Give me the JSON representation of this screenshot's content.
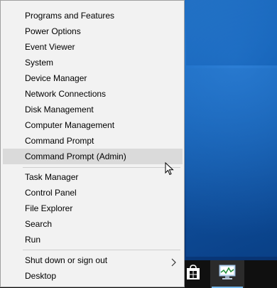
{
  "menu": {
    "group1": [
      {
        "id": "programs-and-features",
        "label": "Programs and Features"
      },
      {
        "id": "power-options",
        "label": "Power Options"
      },
      {
        "id": "event-viewer",
        "label": "Event Viewer"
      },
      {
        "id": "system",
        "label": "System"
      },
      {
        "id": "device-manager",
        "label": "Device Manager"
      },
      {
        "id": "network-connections",
        "label": "Network Connections"
      },
      {
        "id": "disk-management",
        "label": "Disk Management"
      },
      {
        "id": "computer-management",
        "label": "Computer Management"
      },
      {
        "id": "command-prompt",
        "label": "Command Prompt"
      },
      {
        "id": "command-prompt-admin",
        "label": "Command Prompt (Admin)",
        "highlighted": true
      }
    ],
    "group2": [
      {
        "id": "task-manager",
        "label": "Task Manager"
      },
      {
        "id": "control-panel",
        "label": "Control Panel"
      },
      {
        "id": "file-explorer",
        "label": "File Explorer"
      },
      {
        "id": "search",
        "label": "Search"
      },
      {
        "id": "run",
        "label": "Run"
      }
    ],
    "group3": [
      {
        "id": "shut-down-or-sign-out",
        "label": "Shut down or sign out",
        "submenu": true
      },
      {
        "id": "desktop",
        "label": "Desktop"
      }
    ]
  },
  "taskbar": {
    "items": [
      {
        "id": "store",
        "icon": "store-icon"
      },
      {
        "id": "performance-monitor",
        "icon": "performance-monitor-icon",
        "active": true
      }
    ]
  },
  "colors": {
    "menu_background": "#f2f2f2",
    "highlight": "#dadada",
    "taskbar": "#101010",
    "desktop": "#0b3f86"
  }
}
